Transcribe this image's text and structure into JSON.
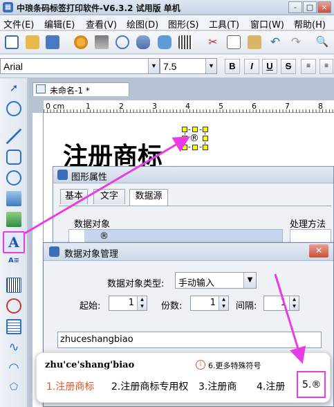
{
  "app": {
    "title": "中琅条码标签打印软件-V6.3.2 试用版 单机",
    "logo": "app-logo"
  },
  "window_controls": [
    "-",
    "□",
    "×"
  ],
  "menu": [
    "文件(E)",
    "编辑(E)",
    "查看(V)",
    "绘图(D)",
    "图形(S)",
    "工具(T)",
    "窗口(W)",
    "帮助(H)"
  ],
  "font": {
    "family": "Arial",
    "size": "7.5",
    "bold": "B",
    "italic": "I",
    "underline": "U",
    "strike": "S"
  },
  "document": {
    "tab": "未命名-1 *",
    "ruler_origin": "0 cm",
    "ruler_marks": [
      "1",
      "2",
      "3",
      "4",
      "5",
      "6",
      "7",
      "8"
    ],
    "canvas_text": "注册商标",
    "selected_symbol": "®"
  },
  "graphic_props": {
    "title": "图形属性",
    "tabs": [
      "基本",
      "文字",
      "数据源"
    ],
    "active_tab": "数据源",
    "data_object_label": "数据对象",
    "data_object_value": "®",
    "processing_label": "处理方法"
  },
  "data_mgr": {
    "title": "数据对象管理",
    "type_label": "数据对象类型:",
    "type_value": "手动输入",
    "start_label": "起始:",
    "start_value": "1",
    "copies_label": "份数:",
    "copies_value": "1",
    "interval_label": "间隔:",
    "interval_value": "1",
    "input_value": "zhuceshangbiao"
  },
  "ime": {
    "pinyin": "zhu'ce'shang'biao",
    "more": "6.更多特殊符号",
    "candidates": [
      "1.注册商标",
      "2.注册商标专用权",
      "3.注册商",
      "4.注册",
      "5.®"
    ]
  },
  "colors": {
    "accent": "#e83de6",
    "ime_first": "#e0562b"
  }
}
